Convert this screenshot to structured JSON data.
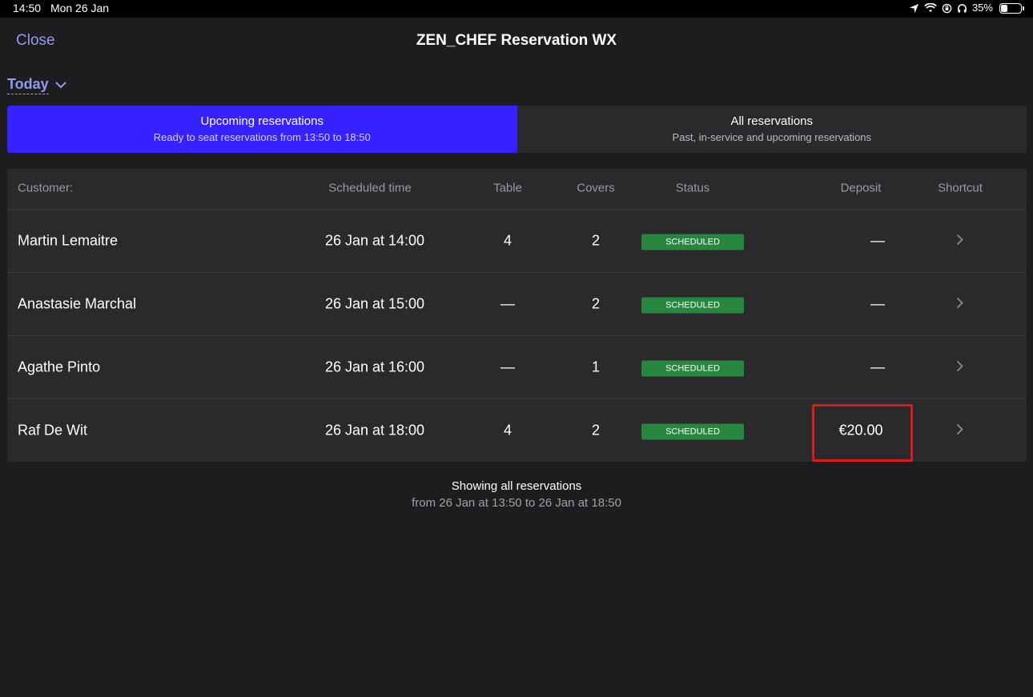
{
  "status_bar": {
    "time": "14:50",
    "date": "Mon 26 Jan",
    "battery_percent_text": "35%",
    "battery_level": 0.35
  },
  "nav": {
    "close_label": "Close",
    "title": "ZEN_CHEF Reservation WX"
  },
  "date_filter": {
    "label": "Today"
  },
  "segments": [
    {
      "title": "Upcoming reservations",
      "subtitle": "Ready to seat reservations from 13:50 to 18:50",
      "active": true
    },
    {
      "title": "All reservations",
      "subtitle": "Past, in-service and upcoming reservations",
      "active": false
    }
  ],
  "table": {
    "headers": {
      "customer": "Customer:",
      "time": "Scheduled time",
      "table": "Table",
      "covers": "Covers",
      "status": "Status",
      "deposit": "Deposit",
      "shortcut": "Shortcut"
    },
    "rows": [
      {
        "customer": "Martin Lemaitre",
        "time": "26 Jan at 14:00",
        "table": "4",
        "covers": "2",
        "status": "SCHEDULED",
        "deposit": "—"
      },
      {
        "customer": "Anastasie Marchal",
        "time": "26 Jan at 15:00",
        "table": "—",
        "covers": "2",
        "status": "SCHEDULED",
        "deposit": "—"
      },
      {
        "customer": "Agathe Pinto",
        "time": "26 Jan at 16:00",
        "table": "—",
        "covers": "1",
        "status": "SCHEDULED",
        "deposit": "—"
      },
      {
        "customer": "Raf De Wit",
        "time": "26 Jan at 18:00",
        "table": "4",
        "covers": "2",
        "status": "SCHEDULED",
        "deposit": "€20.00"
      }
    ]
  },
  "footer": {
    "line1": "Showing all reservations",
    "line2": "from 26 Jan at 13:50 to 26 Jan at 18:50"
  },
  "colors": {
    "background": "#1d1d1f",
    "accent": "#3522ff",
    "link": "#8e9cf2",
    "status_scheduled": "#27873f",
    "highlight": "#d81b1b"
  }
}
